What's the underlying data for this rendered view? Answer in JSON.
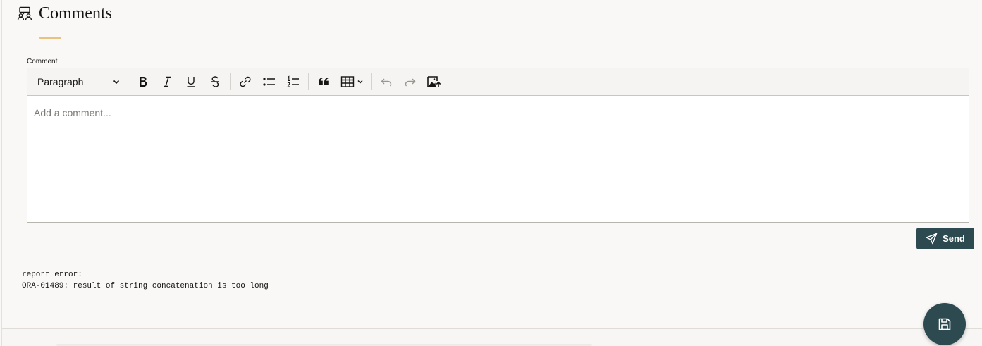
{
  "region": {
    "title": "Comments",
    "icon": "comments-region-icon"
  },
  "comment_field": {
    "label": "Comment",
    "placeholder": "Add a comment..."
  },
  "toolbar": {
    "block_style": "Paragraph",
    "buttons": [
      "bold-icon",
      "italic-icon",
      "underline-icon",
      "strikethrough-icon",
      "link-icon",
      "bulleted-list-icon",
      "numbered-list-icon",
      "blockquote-icon",
      "insert-table-icon",
      "undo-icon",
      "redo-icon",
      "insert-image-icon"
    ]
  },
  "send_button": {
    "label": "Send",
    "icon": "paper-plane-icon"
  },
  "error_output": {
    "line1": "report error:",
    "line2": "ORA-01489: result of string concatenation is too long"
  },
  "fab": {
    "icon": "save-icon"
  },
  "colors": {
    "accent": "#e8c27e",
    "primary": "#2c4a4f",
    "background": "#f9f8f6"
  }
}
